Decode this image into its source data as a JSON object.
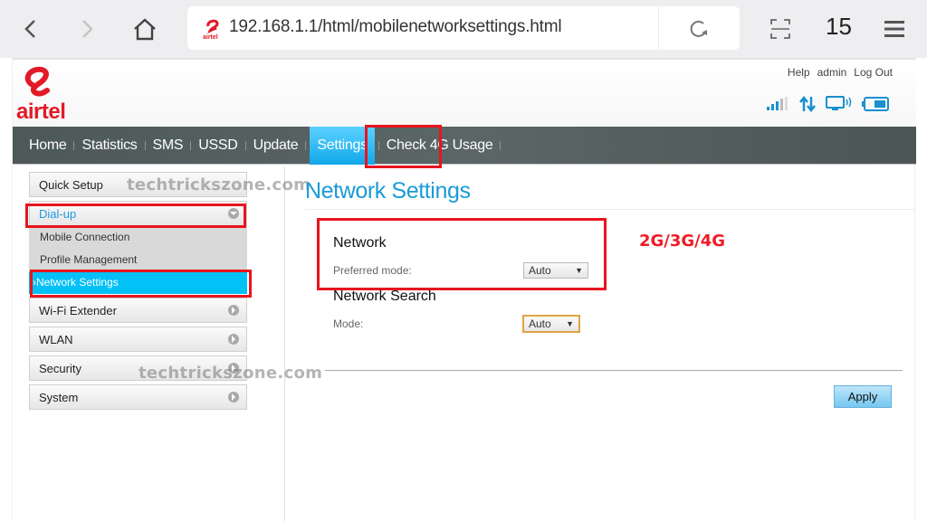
{
  "browser": {
    "url": "192.168.1.1/html/mobilenetworksettings.html",
    "tab_count": "15",
    "favicon_label": "airtel",
    "icons": [
      "back-icon",
      "forward-icon",
      "home-icon",
      "reload-icon",
      "screenshot-icon",
      "menu-icon"
    ]
  },
  "header": {
    "logo_text": "airtel",
    "links": {
      "help": "Help",
      "user": "admin",
      "logout": "Log Out"
    },
    "status_icons": [
      "signal-strength-icon",
      "data-transfer-icon",
      "connected-device-icon",
      "battery-icon"
    ]
  },
  "navbar": {
    "items": [
      {
        "label": "Home"
      },
      {
        "label": "Statistics"
      },
      {
        "label": "SMS"
      },
      {
        "label": "USSD"
      },
      {
        "label": "Update"
      },
      {
        "label": "Settings",
        "active": true
      },
      {
        "label": "Check 4G Usage"
      }
    ]
  },
  "sidebar": {
    "items": [
      {
        "label": "Quick Setup"
      },
      {
        "label": "Dial-up",
        "expanded": true,
        "children": [
          {
            "label": "Mobile Connection"
          },
          {
            "label": "Profile Management"
          },
          {
            "label": "Network Settings",
            "selected": true
          }
        ]
      },
      {
        "label": "Wi-Fi Extender"
      },
      {
        "label": "WLAN"
      },
      {
        "label": "Security"
      },
      {
        "label": "System"
      }
    ]
  },
  "main": {
    "title": "Network Settings",
    "network": {
      "heading": "Network",
      "preferred_mode_label": "Preferred mode:",
      "preferred_mode_value": "Auto"
    },
    "network_search": {
      "heading": "Network Search",
      "mode_label": "Mode:",
      "mode_value": "Auto"
    },
    "apply_label": "Apply"
  },
  "annotations": {
    "mode_note": "2G/3G/4G",
    "watermark": "techtrickszone.com",
    "highlight_color": "#e8141f"
  },
  "colors": {
    "brand_red": "#e11a28",
    "accent_blue": "#1a9bd7",
    "selected_blue": "#03c0f6",
    "navbar": "#56615f"
  }
}
